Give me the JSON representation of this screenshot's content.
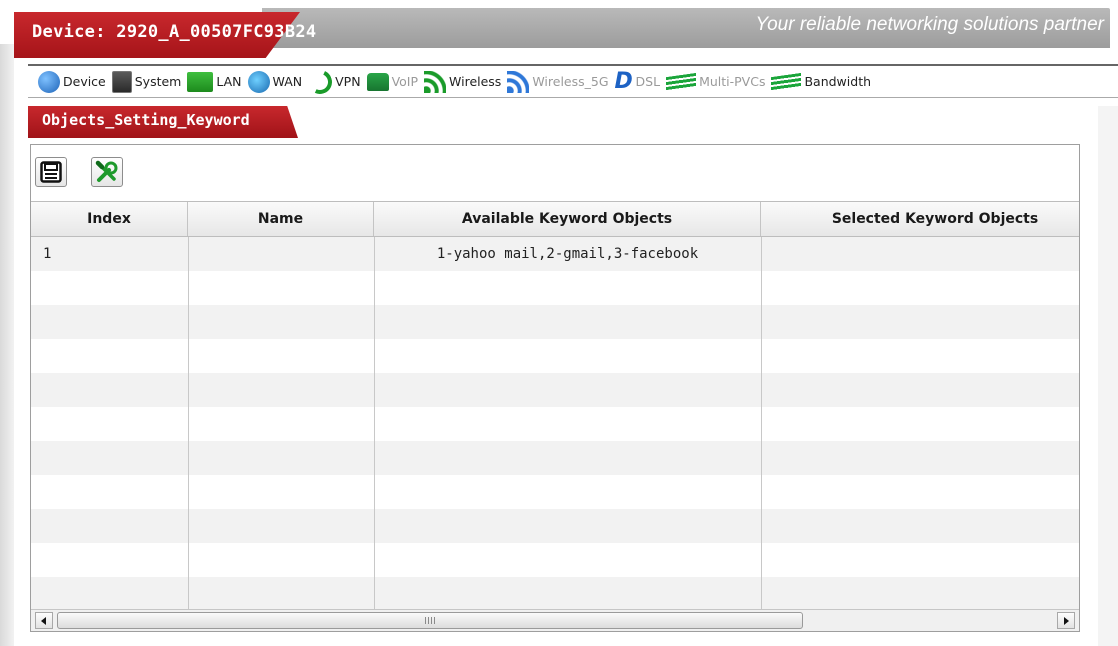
{
  "header": {
    "device": "Device: 2920_A_00507FC93B24",
    "tagline": "Your reliable networking solutions partner"
  },
  "nav": [
    {
      "label": "Device",
      "icon": "device-icon"
    },
    {
      "label": "System",
      "icon": "system-icon"
    },
    {
      "label": "LAN",
      "icon": "lan-icon"
    },
    {
      "label": "WAN",
      "icon": "wan-icon"
    },
    {
      "label": "VPN",
      "icon": "vpn-icon"
    },
    {
      "label": "VoIP",
      "icon": "voip-icon"
    },
    {
      "label": "Wireless",
      "icon": "wireless-icon"
    },
    {
      "label": "Wireless_5G",
      "icon": "wireless-5g-icon"
    },
    {
      "label": "DSL",
      "icon": "dsl-icon"
    },
    {
      "label": "Multi-PVCs",
      "icon": "multi-pvcs-icon"
    },
    {
      "label": "Bandwidth",
      "icon": "bandwidth-icon"
    }
  ],
  "tab": {
    "label": "Objects_Setting_Keyword"
  },
  "toolbar": {
    "save_icon": "floppy-disk-icon",
    "tools_icon": "wrench-screwdriver-icon"
  },
  "table": {
    "columns": [
      "Index",
      "Name",
      "Available Keyword Objects",
      "Selected Keyword Objects"
    ],
    "rows": [
      {
        "index": "1",
        "name": "",
        "available": "1-yahoo mail,2-gmail,3-facebook",
        "selected": ""
      }
    ]
  },
  "colors": {
    "brand_red": "#b81d22",
    "header_gray": "#a8a8a8"
  }
}
